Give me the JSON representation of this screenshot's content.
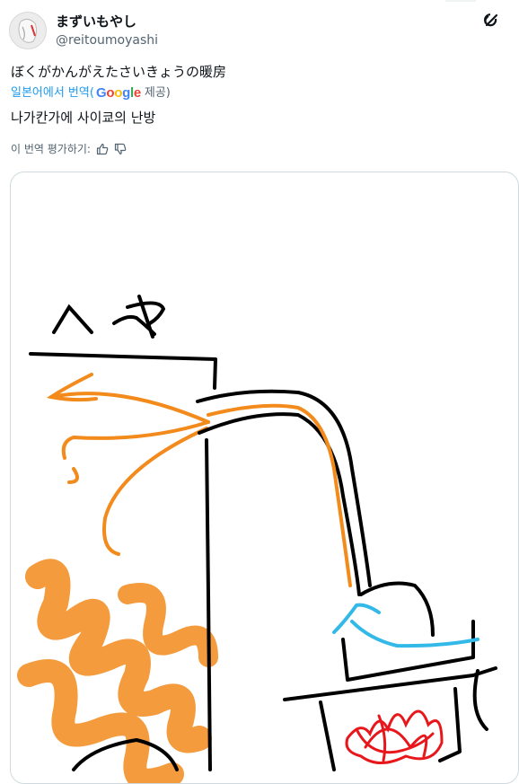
{
  "author": {
    "display_name": "まずいもやし",
    "handle": "@reitoumoyashi",
    "avatar": "avatar-image"
  },
  "post": {
    "text": "ぼくがかんがえたさいきょうの暖房",
    "translate_prefix": "일본어에서 번역(",
    "translate_brand": "Google",
    "translate_suffix": "제공)",
    "translated_text": "나가칸가에 사이쿄의 난방",
    "rate_label": "이 번역 평가하기:"
  },
  "icons": {
    "grok": "grok-icon",
    "thumbs_up": "thumbs-up-icon",
    "thumbs_down": "thumbs-down-icon"
  },
  "media": {
    "drawing_text": "ヘヤ",
    "colors": {
      "black": "#000000",
      "orange": "#f28a1c",
      "blue": "#33b9e8",
      "red": "#e8171c"
    }
  }
}
